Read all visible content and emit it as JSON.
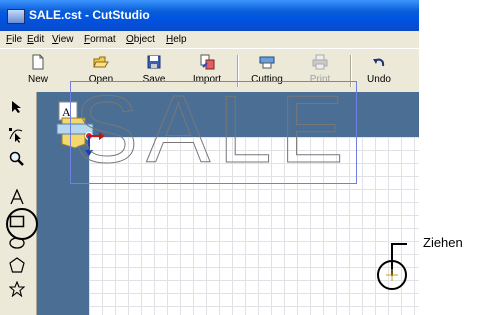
{
  "window": {
    "title": "SALE.cst - CutStudio"
  },
  "menu": [
    "File",
    "Edit",
    "View",
    "Format",
    "Object",
    "Help"
  ],
  "toolbar": {
    "new": "New",
    "open": "Open",
    "save": "Save",
    "import": "Import",
    "cutting": "Cutting",
    "print": "Print",
    "undo": "Undo"
  },
  "tools": [
    "select-arrow-icon",
    "node-edit-icon",
    "zoom-icon",
    "text-icon",
    "rectangle-icon",
    "ellipse-icon",
    "polygon-icon",
    "star-icon"
  ],
  "canvas": {
    "text": "SALE"
  },
  "annotation": {
    "label": "Ziehen"
  },
  "colors": {
    "titlebar": "#0054e3",
    "workspace": "#4b6f94",
    "selection": "#7080e0"
  }
}
